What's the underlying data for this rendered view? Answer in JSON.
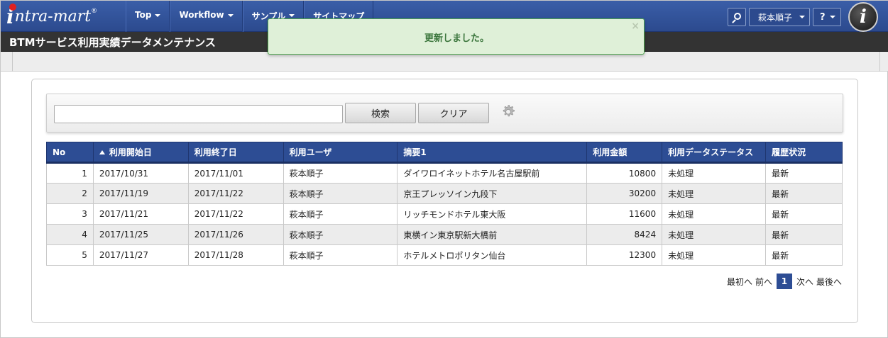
{
  "app": {
    "logo_text": "ntra-mart",
    "logo_initial": "i",
    "logo_reg": "®"
  },
  "nav": {
    "items": [
      {
        "label": "Top",
        "has_caret": true
      },
      {
        "label": "Workflow",
        "has_caret": true
      },
      {
        "label": "サンプル",
        "has_caret": true
      },
      {
        "label": "サイトマップ",
        "has_caret": false
      }
    ]
  },
  "header": {
    "user_name": "萩本順子",
    "help_label": "?",
    "badge_letter": "i"
  },
  "page": {
    "title": "BTMサービス利用実績データメンテナンス"
  },
  "toast": {
    "message": "更新しました。",
    "close": "×"
  },
  "search": {
    "value": "",
    "placeholder": "",
    "search_label": "検索",
    "clear_label": "クリア"
  },
  "table": {
    "columns": [
      "No",
      "利用開始日",
      "利用終了日",
      "利用ユーザ",
      "摘要1",
      "利用金額",
      "利用データステータス",
      "履歴状況"
    ],
    "rows": [
      [
        "1",
        "2017/10/31",
        "2017/11/01",
        "萩本順子",
        "ダイワロイネットホテル名古屋駅前",
        "10800",
        "未処理",
        "最新"
      ],
      [
        "2",
        "2017/11/19",
        "2017/11/22",
        "萩本順子",
        "京王プレッソイン九段下",
        "30200",
        "未処理",
        "最新"
      ],
      [
        "3",
        "2017/11/21",
        "2017/11/22",
        "萩本順子",
        "リッチモンドホテル東大阪",
        "11600",
        "未処理",
        "最新"
      ],
      [
        "4",
        "2017/11/25",
        "2017/11/26",
        "萩本順子",
        "東横イン東京駅新大橋前",
        "8424",
        "未処理",
        "最新"
      ],
      [
        "5",
        "2017/11/27",
        "2017/11/28",
        "萩本順子",
        "ホテルメトロポリタン仙台",
        "12300",
        "未処理",
        "最新"
      ]
    ]
  },
  "pager": {
    "first": "最初へ",
    "prev": "前へ",
    "current": "1",
    "next": "次へ",
    "last": "最後へ"
  },
  "colors": {
    "nav_blue": "#2c4a8e",
    "table_header": "#2d4d94",
    "toast_bg": "#dff0d8",
    "toast_text": "#3c763d"
  }
}
